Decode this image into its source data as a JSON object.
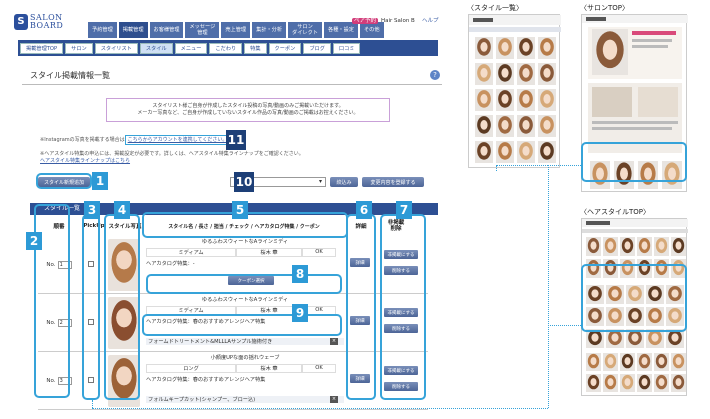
{
  "logo": {
    "mark": "S",
    "line1": "SALON",
    "line2": "BOARD"
  },
  "top_nav": [
    {
      "label": "予約管理"
    },
    {
      "label": "掲載管理",
      "active": true
    },
    {
      "label": "お客様管理"
    },
    {
      "label": "メッセージ\n管理"
    },
    {
      "label": "売上管理"
    },
    {
      "label": "集計・分析"
    },
    {
      "label": "サロン\nダイレクト"
    },
    {
      "label": "各種・設定"
    },
    {
      "label": "その他"
    }
  ],
  "header": {
    "badge": "ペア予約",
    "shop_name": "Hair Salon B",
    "help": "ヘルプ"
  },
  "sub_nav": [
    {
      "label": "掲載管理TOP"
    },
    {
      "label": "サロン"
    },
    {
      "label": "スタイリスト"
    },
    {
      "label": "スタイル",
      "active": true
    },
    {
      "label": "メニュー"
    },
    {
      "label": "こだわり"
    },
    {
      "label": "特集"
    },
    {
      "label": "クーポン"
    },
    {
      "label": "ブログ"
    },
    {
      "label": "口コミ"
    }
  ],
  "page_title": "スタイル掲載情報一覧",
  "notice": {
    "line1": "スタイリスト様ご自身が作成したスタイル投稿の写真/動画のみご掲載いただけます。",
    "line2": "メーカー写真など、ご自身が作成していないスタイル作品の写真/動画のご掲載はお控えください。"
  },
  "instagram": {
    "prefix": "※Instagramの写真を掲載する場合は",
    "link": "こちらからアカウントを連携してください。"
  },
  "hair_style_note": "※ヘアスタイル特集の申込には、掲載設定が必要です。詳しくは、ヘアスタイル特集ラインナップをご確認ください。",
  "hair_style_link": "ヘアスタイル特集ラインナップはこちら",
  "toolbar": {
    "add_button": "スタイル新規追加",
    "refine_button": "絞込み",
    "save_order_button": "変更内容を登録する"
  },
  "table": {
    "bar_title": "スタイル一覧",
    "columns": {
      "order": "順番",
      "pickup": "PickUp",
      "photo": "スタイル写真",
      "info": "スタイル名 / 長さ / 担当 / チェック / ヘアカタログ特集 / クーポン",
      "detail": "詳細",
      "publish": "非掲載\n削除"
    },
    "no_label": "No.",
    "rows": [
      {
        "no": "1",
        "name": "ゆるふわスウィートなAラインミディ",
        "length": "ミディアム",
        "stylist": "桜木 華",
        "check": "OK",
        "catalog_label": "ヘアカタログ特集：-",
        "coupon_button": "クーポン選択",
        "hair_color": "#b57a4a"
      },
      {
        "no": "2",
        "name": "ゆるふわスウィートなAラインミディ",
        "length": "ミディアム",
        "stylist": "桜木 華",
        "check": "OK",
        "catalog_label": "ヘアカタログ特集：春のおすすめアレンジヘア特集",
        "extra": "フォームドトリートメント&MLLLAサンプル施術付き",
        "hair_color": "#8a4e30"
      },
      {
        "no": "3",
        "name": "小顔度UPな面の揺れウェーブ",
        "length": "ロング",
        "stylist": "桜木 華",
        "check": "OK",
        "catalog_label": "ヘアカタログ特集：春のおすすめアレンジヘア特集",
        "extra": "フォルムキープカット(シャンプー、ブロー込)",
        "hair_color": "#9c6238"
      }
    ],
    "detail_label": "詳細",
    "publish_label": "非掲載にする",
    "delete_label": "削除する",
    "edit_label": "編集"
  },
  "callouts": [
    "1",
    "2",
    "3",
    "4",
    "5",
    "6",
    "7",
    "8",
    "9",
    "10",
    "11"
  ],
  "captions": {
    "style_list": "〈スタイル一覧〉",
    "salon_top": "〈サロンTOP〉",
    "hairstyle_top": "〈ヘアスタイルTOP〉"
  },
  "colors": {
    "nav": "#2d4f93",
    "accent": "#36a3d9",
    "badge": "#2d9ad6"
  }
}
